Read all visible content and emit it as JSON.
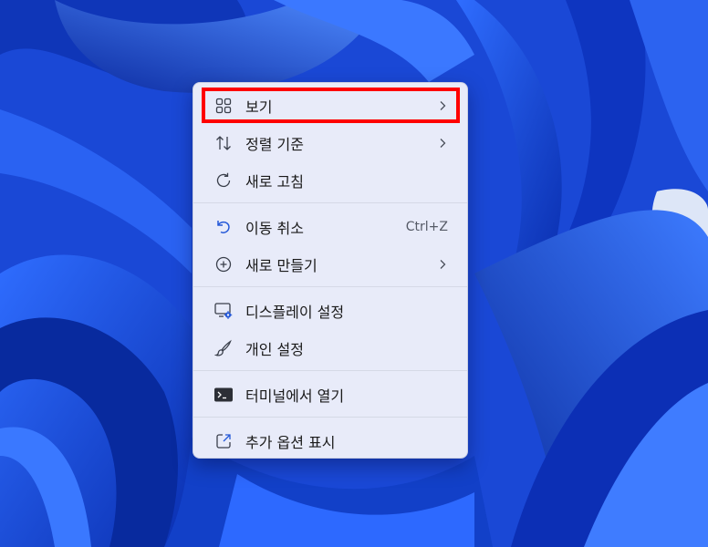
{
  "menu": {
    "items": [
      {
        "label": "보기",
        "icon": "grid-view-icon",
        "submenu": true
      },
      {
        "label": "정렬 기준",
        "icon": "sort-arrows-icon",
        "submenu": true
      },
      {
        "label": "새로 고침",
        "icon": "refresh-icon",
        "submenu": false
      },
      {
        "label": "이동 취소",
        "icon": "undo-icon",
        "shortcut": "Ctrl+Z",
        "submenu": false
      },
      {
        "label": "새로 만들기",
        "icon": "add-circle-icon",
        "submenu": true
      },
      {
        "label": "디스플레이 설정",
        "icon": "display-settings-icon",
        "submenu": false
      },
      {
        "label": "개인 설정",
        "icon": "brush-icon",
        "submenu": false
      },
      {
        "label": "터미널에서 열기",
        "icon": "terminal-icon",
        "submenu": false
      },
      {
        "label": "추가 옵션 표시",
        "icon": "show-more-icon",
        "submenu": false
      }
    ]
  },
  "colors": {
    "accent": "#2458d8",
    "highlight_border": "#ff0000",
    "menu_background": "#eff1fa",
    "wallpaper": "#1b4fe0"
  }
}
